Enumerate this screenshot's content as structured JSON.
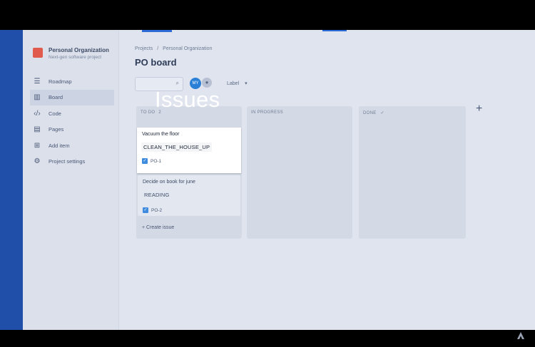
{
  "sidebar": {
    "project_name": "Personal Organization",
    "project_sub": "Next-gen software project",
    "items": [
      {
        "label": "Roadmap",
        "icon": "roadmap-icon"
      },
      {
        "label": "Board",
        "icon": "board-icon"
      },
      {
        "label": "Code",
        "icon": "code-icon"
      },
      {
        "label": "Pages",
        "icon": "pages-icon"
      },
      {
        "label": "Add item",
        "icon": "add-item-icon"
      },
      {
        "label": "Project settings",
        "icon": "gear-icon"
      }
    ]
  },
  "breadcrumb": {
    "root": "Projects",
    "sep": "/",
    "current": "Personal Organization"
  },
  "page": {
    "title": "PO board",
    "overlay_caption": "Issues"
  },
  "toolbar": {
    "avatar_initials": "MY",
    "label_filter": "Label"
  },
  "columns": [
    {
      "title": "TO DO",
      "count": "2"
    },
    {
      "title": "IN PROGRESS"
    },
    {
      "title": "DONE",
      "check": "✓"
    }
  ],
  "cards": [
    {
      "title": "Vacuum the floor",
      "tag": "CLEAN_THE_HOUSE_UP",
      "key": "PO-1"
    },
    {
      "title": "Decide on book for june",
      "tag": "READING",
      "key": "PO-2"
    }
  ],
  "create_issue": "+ Create issue",
  "add_column": "+"
}
